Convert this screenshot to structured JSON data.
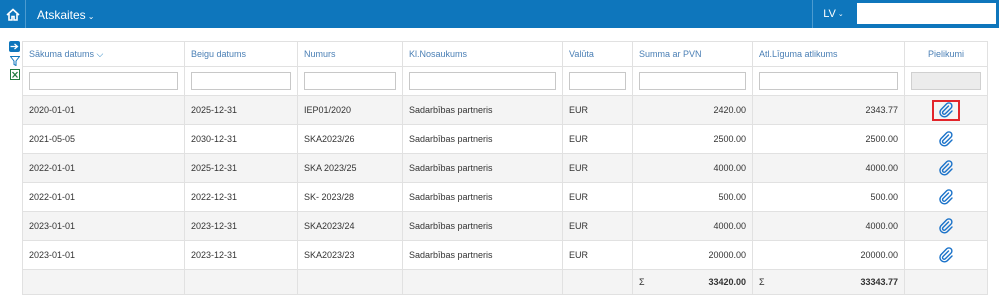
{
  "topbar": {
    "title": "Atskaites",
    "language": "LV",
    "search_value": ""
  },
  "table": {
    "headers": {
      "start": "Sākuma datums",
      "end": "Beigu datums",
      "number": "Numurs",
      "client": "Kl.Nosaukums",
      "currency": "Valūta",
      "sum": "Summa ar PVN",
      "remaining": "Atl.Līguma atlikums",
      "attachments": "Pielikumi"
    },
    "rows": [
      {
        "start": "2020-01-01",
        "end": "2025-12-31",
        "number": "IEP01/2020",
        "client": "Sadarbības partneris",
        "currency": "EUR",
        "sum": "2420.00",
        "remaining": "2343.77"
      },
      {
        "start": "2021-05-05",
        "end": "2030-12-31",
        "number": "SKA2023/26",
        "client": "Sadarbības partneris",
        "currency": "EUR",
        "sum": "2500.00",
        "remaining": "2500.00"
      },
      {
        "start": "2022-01-01",
        "end": "2025-12-31",
        "number": "SKA 2023/25",
        "client": "Sadarbības partneris",
        "currency": "EUR",
        "sum": "4000.00",
        "remaining": "4000.00"
      },
      {
        "start": "2022-01-01",
        "end": "2022-12-31",
        "number": "SK- 2023/28",
        "client": "Sadarbības partneris",
        "currency": "EUR",
        "sum": "500.00",
        "remaining": "500.00"
      },
      {
        "start": "2023-01-01",
        "end": "2023-12-31",
        "number": "SKA2023/24",
        "client": "Sadarbības partneris",
        "currency": "EUR",
        "sum": "4000.00",
        "remaining": "4000.00"
      },
      {
        "start": "2023-01-01",
        "end": "2023-12-31",
        "number": "SKA2023/23",
        "client": "Sadarbības partneris",
        "currency": "EUR",
        "sum": "20000.00",
        "remaining": "20000.00"
      }
    ],
    "totals": {
      "sigma": "Σ",
      "sum": "33420.00",
      "remaining": "33343.77"
    }
  },
  "icons": {
    "home": "home-icon",
    "arrow": "arrow-right-icon",
    "filter": "filter-icon",
    "excel": "excel-export-icon",
    "attachment": "paperclip-icon"
  },
  "colors": {
    "brand": "#0e76bc",
    "highlight": "#e2242a",
    "header_text": "#4a7fb5"
  }
}
